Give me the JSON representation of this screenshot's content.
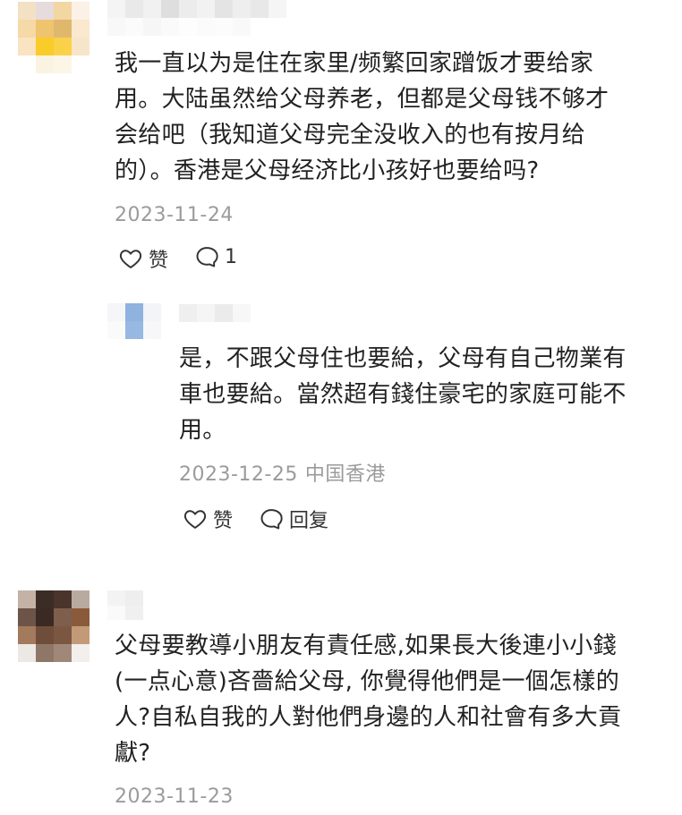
{
  "comments": [
    {
      "text_lines": [
        "我一直以为是住在家里/频繁回家蹭饭才要给家",
        "用。大陆虽然给父母养老，但都是父母钱不够才",
        "会给吧（我知道父母完全没收入的也有按月给",
        "的）。香港是父母经济比小孩好也要给吗?"
      ],
      "date": "2023-11-24",
      "like_label": "赞",
      "reply_count": "1"
    },
    {
      "text_lines": [
        "是，不跟父母住也要給，父母有自己物業有",
        "車也要給。當然超有錢住豪宅的家庭可能不",
        "用。"
      ],
      "date": "2023-12-25",
      "location": "中国香港",
      "like_label": "赞",
      "reply_label": "回复"
    },
    {
      "text_lines": [
        "父母要教導小朋友有責任感,如果長大後連小小錢",
        "(一点心意)吝嗇給父母, 你覺得他們是一個怎樣的",
        "人?自私自我的人對他們身邊的人和社會有多大貢",
        "獻?"
      ],
      "date": "2023-11-23"
    }
  ],
  "colors": {
    "text": "#222222",
    "meta": "#9b9b9b",
    "icon": "#333333"
  }
}
